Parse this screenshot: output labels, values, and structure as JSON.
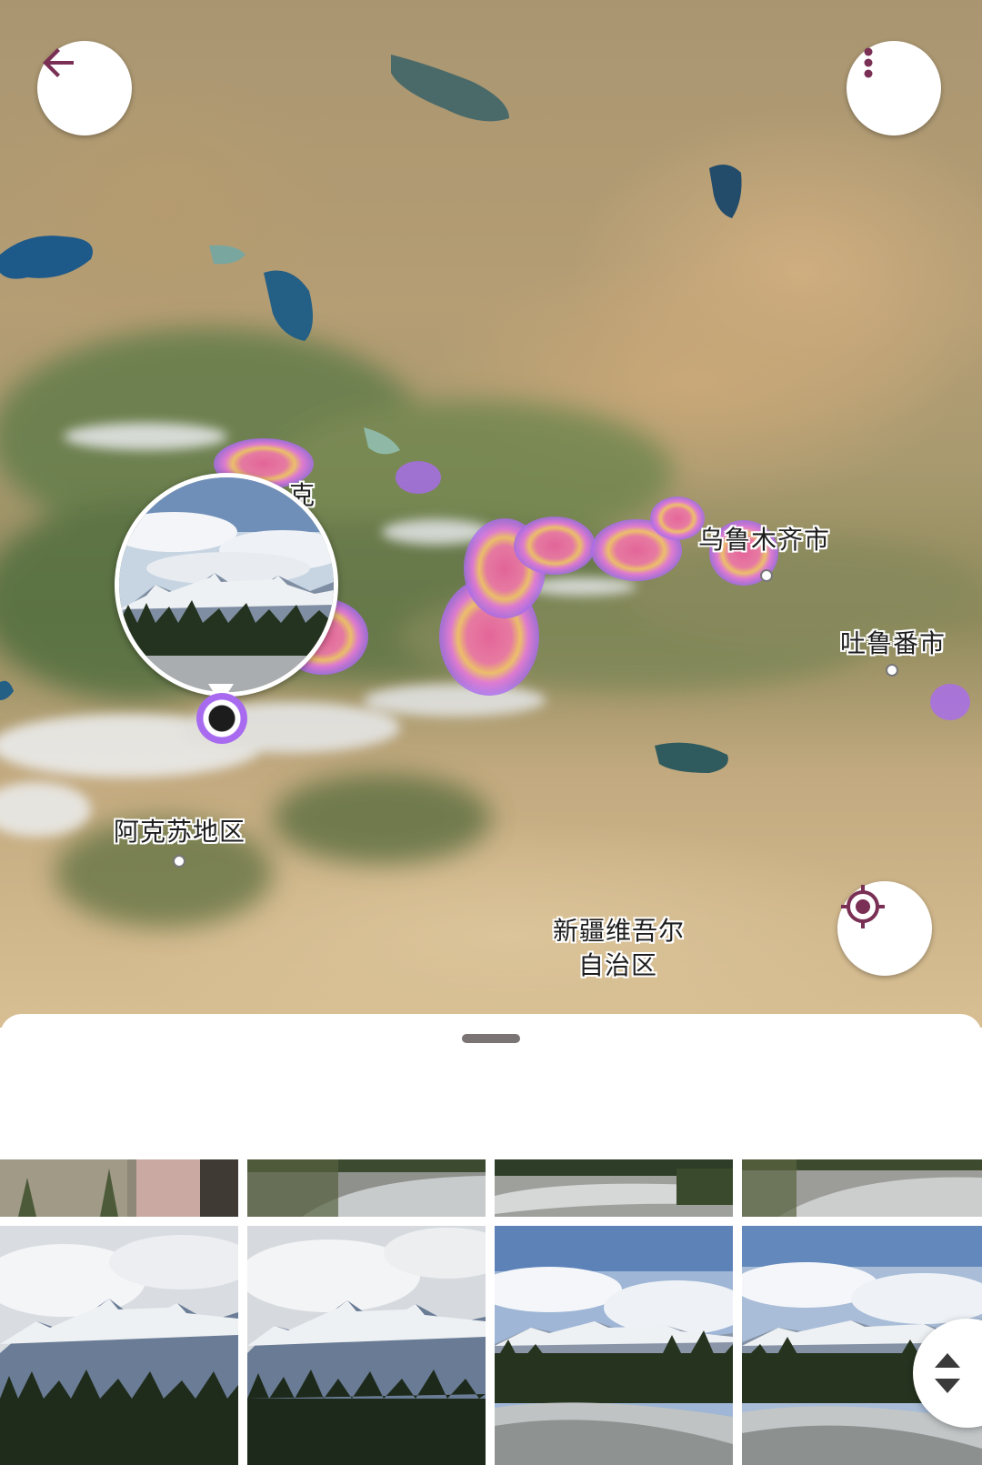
{
  "map": {
    "labels": {
      "partial_top": "克",
      "urumqi": "乌鲁木齐市",
      "turpan": "吐鲁番市",
      "aksu": "阿克苏地区",
      "xinjiang_line1": "新疆维吾尔",
      "xinjiang_line2": "自治区"
    },
    "heatmap_colors": [
      "#a86bf0",
      "#e86bc8",
      "#f29a6b",
      "#f2d46b"
    ]
  },
  "toolbar": {
    "back_icon": "arrow-back-icon",
    "more_icon": "more-vert-icon",
    "locate_icon": "my-location-icon",
    "accent_color": "#7a2f55"
  },
  "sheet": {
    "handle_icon": "drag-handle",
    "photos": [
      {
        "scene": "forest-slope"
      },
      {
        "scene": "river-bed"
      },
      {
        "scene": "river-forest"
      },
      {
        "scene": "river-bed"
      },
      {
        "scene": "mountains-cloudy"
      },
      {
        "scene": "mountains-cloudy"
      },
      {
        "scene": "mountains-river"
      },
      {
        "scene": "mountains-river"
      }
    ],
    "fast_scroll_icon": "unfold-icon"
  }
}
